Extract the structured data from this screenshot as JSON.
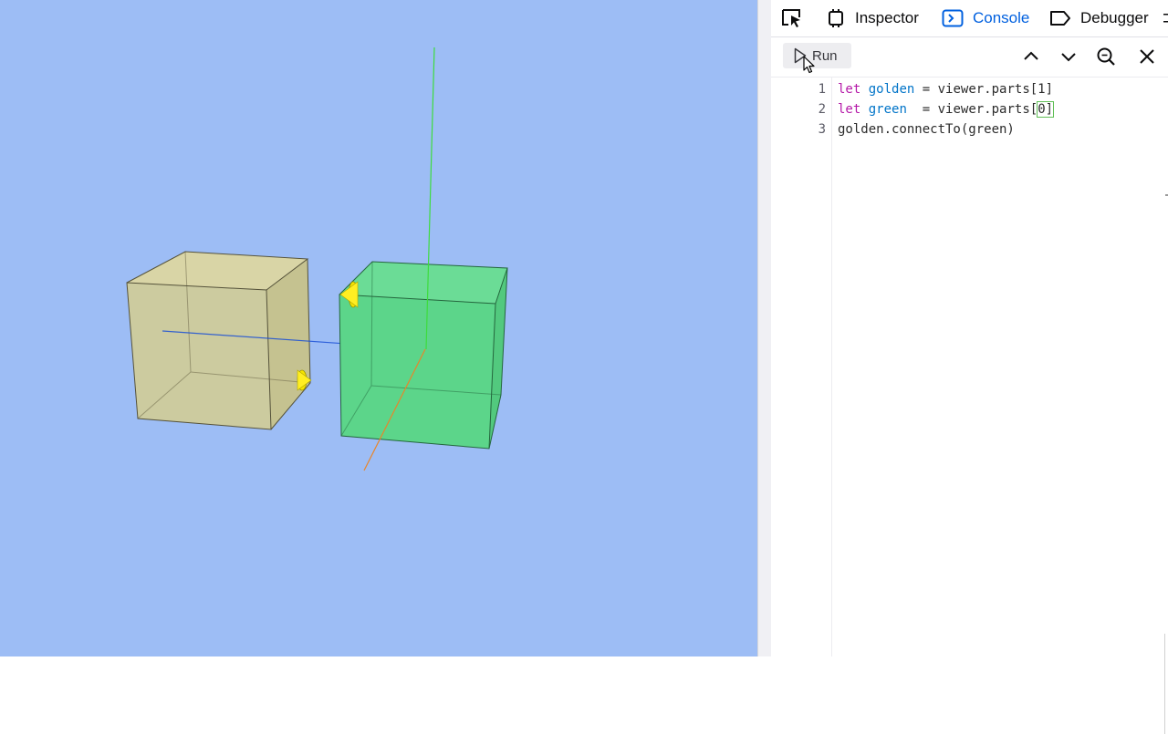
{
  "devtools": {
    "tabs": [
      {
        "label": "Inspector",
        "icon": "inspector-icon",
        "selected": false
      },
      {
        "label": "Console",
        "icon": "console-icon",
        "selected": true
      },
      {
        "label": "Debugger",
        "icon": "debugger-icon",
        "selected": false
      }
    ],
    "toolbar": {
      "run_label": "Run",
      "icons": [
        "chevron-up-icon",
        "chevron-down-icon",
        "search-icon",
        "close-icon"
      ]
    },
    "editor": {
      "line_numbers": [
        "1",
        "2",
        "3"
      ],
      "lines": [
        {
          "keyword": "let",
          "var": "golden",
          "rest": " = viewer.parts[1]"
        },
        {
          "keyword": "let",
          "var": "green",
          "rest_pre": "  = viewer.parts[",
          "highlight": "0]",
          "rest_post": ""
        },
        {
          "text": "golden.connectTo(green)"
        }
      ]
    }
  },
  "viewport": {
    "background": "#9dbdf5",
    "objects": [
      {
        "name": "golden-box",
        "color": "#d1cd9c"
      },
      {
        "name": "green-box",
        "color": "#5ed68a"
      },
      {
        "name": "connector",
        "color": "#ffee00"
      }
    ],
    "axes": {
      "x": "#e8852a",
      "y": "#3ddc3d",
      "z": "#1a4fd6"
    }
  }
}
